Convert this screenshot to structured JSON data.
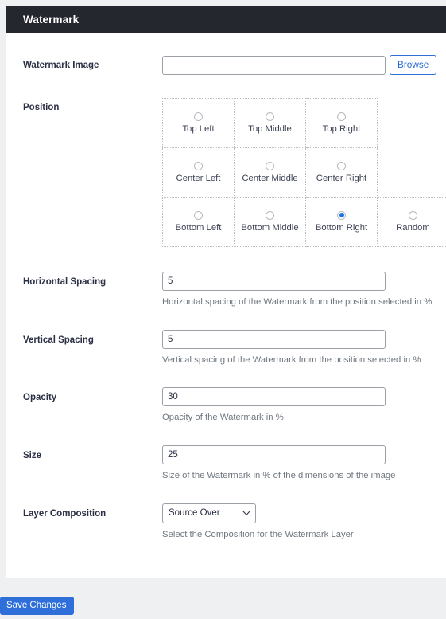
{
  "card": {
    "title": "Watermark"
  },
  "fields": {
    "watermark_image": {
      "label": "Watermark Image",
      "value": "",
      "placeholder": "",
      "browse_label": "Browse"
    },
    "position": {
      "label": "Position",
      "selected": "Bottom Right",
      "options": [
        "Top Left",
        "Top Middle",
        "Top Right",
        "Center Left",
        "Center Middle",
        "Center Right",
        "Bottom Left",
        "Bottom Middle",
        "Bottom Right",
        "Random"
      ]
    },
    "horizontal_spacing": {
      "label": "Horizontal Spacing",
      "value": "5",
      "help": "Horizontal spacing of the Watermark from the position selected in %"
    },
    "vertical_spacing": {
      "label": "Vertical Spacing",
      "value": "5",
      "help": "Vertical spacing of the Watermark from the position selected in %"
    },
    "opacity": {
      "label": "Opacity",
      "value": "30",
      "help": "Opacity of the Watermark in %"
    },
    "size": {
      "label": "Size",
      "value": "25",
      "help": "Size of the Watermark in % of the dimensions of the image"
    },
    "layer_composition": {
      "label": "Layer Composition",
      "value": "Source Over",
      "help": "Select the Composition for the Watermark Layer"
    }
  },
  "footer": {
    "save_label": "Save Changes"
  },
  "colors": {
    "header_bg": "#24272e",
    "accent_blue": "#2e6fd9",
    "radio_selected": "#1a73e8",
    "help_text": "#6f7780",
    "label_text": "#2b3045",
    "page_bg": "#eef0f1"
  }
}
